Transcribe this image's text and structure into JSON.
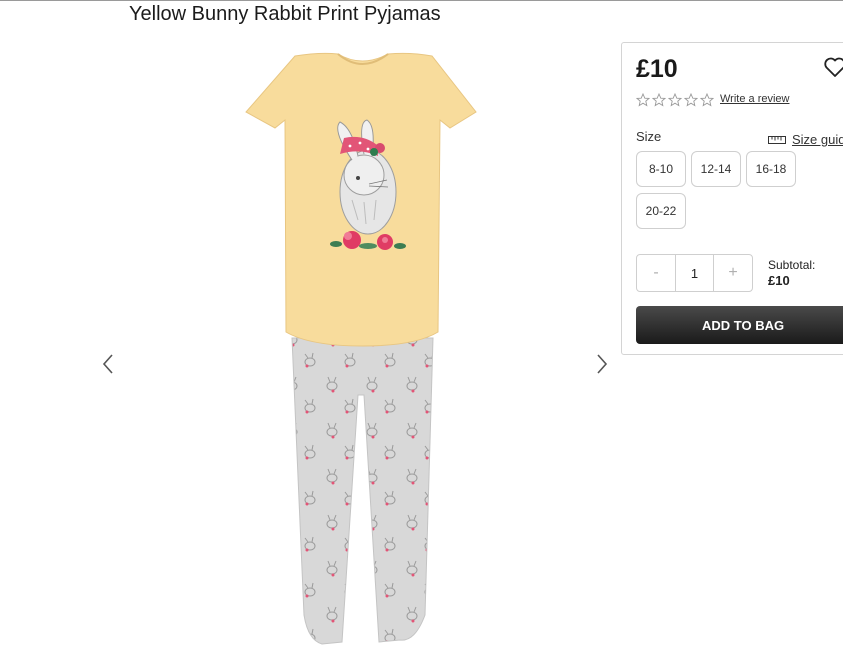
{
  "product": {
    "title": "Yellow Bunny Rabbit Print Pyjamas",
    "price": "£10",
    "review_link": "Write a review",
    "rating_icons": [
      "star-outline-icon",
      "star-outline-icon",
      "star-outline-icon",
      "star-outline-icon",
      "star-outline-icon"
    ]
  },
  "size": {
    "label": "Size",
    "guide_label": "Size guide",
    "options": [
      "8-10",
      "12-14",
      "16-18",
      "20-22"
    ]
  },
  "quantity": {
    "decrement": "-",
    "value": "1",
    "increment": "+"
  },
  "subtotal": {
    "label": "Subtotal:",
    "value": "£10"
  },
  "add_to_bag": "ADD TO BAG",
  "colors": {
    "tee": "#f8dc9c",
    "pants": "#d9d9d9",
    "button": "#1f1f1f",
    "accent_pink": "#e25577"
  }
}
